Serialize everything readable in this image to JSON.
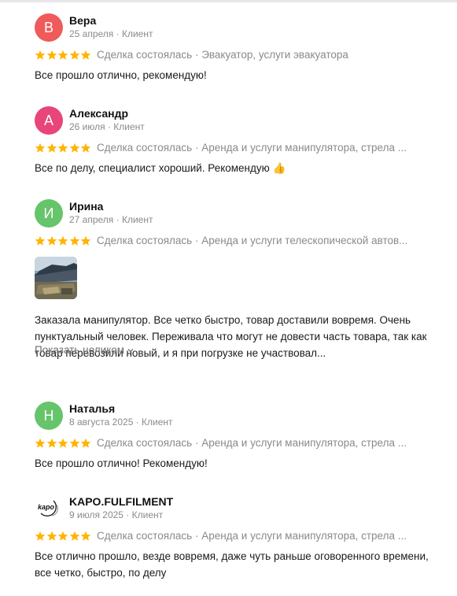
{
  "reviews": [
    {
      "initial": "В",
      "avatar_color": "#ef5a5a",
      "name": "Вера",
      "meta": "25 апреля · Клиент",
      "rating": 5,
      "deal": "Сделка состоялась · Эвакуатор, услуги эвакуатора",
      "text": "Все прошло отлично, рекомендую!"
    },
    {
      "initial": "А",
      "avatar_color": "#e8457a",
      "name": "Александр",
      "meta": "26 июля · Клиент",
      "rating": 5,
      "deal": "Сделка состоялась · Аренда и услуги манипулятора, стрела ...",
      "text": "Все по делу, специалист хороший. Рекомендую 👍"
    },
    {
      "initial": "И",
      "avatar_color": "#66c46a",
      "name": "Ирина",
      "meta": "27 апреля · Клиент",
      "rating": 5,
      "deal": "Сделка состоялась · Аренда и услуги телескопической автов...",
      "text": "Заказала манипулятор. Все четко быстро, товар доставили вовремя. Очень пунктуальный человек. Переживала что могут не довести часть товара, так как товар перевозили новый, и я при погрузке не участвовал...",
      "show_more": "Показать целиком"
    },
    {
      "initial": "Н",
      "avatar_color": "#66c46a",
      "name": "Наталья",
      "meta": "8 августа 2025 · Клиент",
      "rating": 5,
      "deal": "Сделка состоялась · Аренда и услуги манипулятора, стрела ...",
      "text": "Все прошло отлично! Рекомендую!"
    },
    {
      "logo_text": "kapo",
      "name": "KAPO.FULFILMENT",
      "meta": "9 июля 2025 · Клиент",
      "rating": 5,
      "deal": "Сделка состоялась · Аренда и услуги манипулятора, стрела ...",
      "text": "Все отлично прошло, везде вовремя, даже чуть раньше оговоренного времени, все четко, быстро, по делу"
    }
  ],
  "colors": {
    "star": "#ffb400",
    "muted": "#8a8a8f",
    "text": "#1a1a1a"
  },
  "icons": {
    "star": "star-icon",
    "chevron": "chevron-down-icon",
    "thumbs_up": "thumbs-up-emoji"
  }
}
